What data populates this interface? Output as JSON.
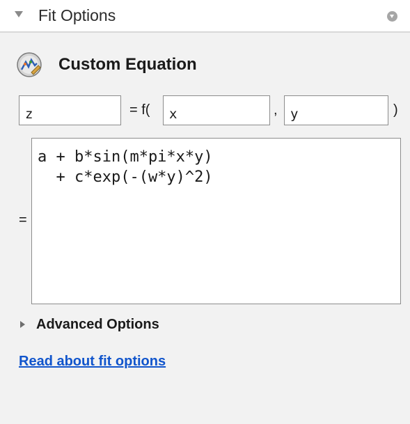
{
  "panel": {
    "title": "Fit Options",
    "fit_type": "Custom Equation",
    "icons": [
      "collapse-arrow-icon",
      "panel-menu-icon",
      "custom-equation-icon",
      "expand-arrow-icon"
    ]
  },
  "equation": {
    "output_var": "z",
    "equals_f_label": "= f(",
    "input_x": "x",
    "comma_label": ",",
    "input_y": "y",
    "close_paren_label": ")",
    "equals_label": "=",
    "expression": "a + b*sin(m*pi*x*y)\n  + c*exp(-(w*y)^2)"
  },
  "advanced_options": {
    "label": "Advanced Options",
    "expanded": false
  },
  "help_link": {
    "label": "Read about fit options"
  },
  "colors": {
    "link": "#1155cc",
    "panel_background": "#f2f2f2",
    "header_background": "#ffffff"
  }
}
